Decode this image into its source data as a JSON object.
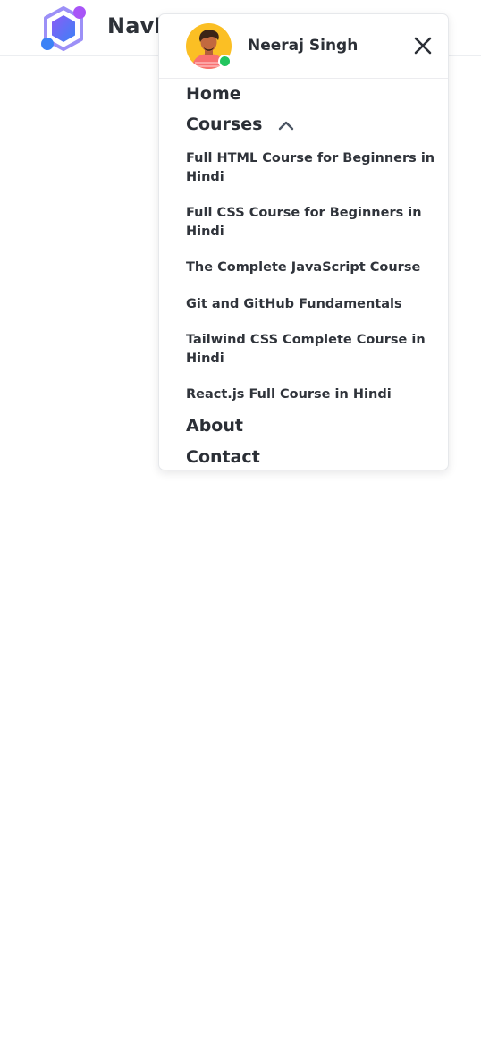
{
  "navbar": {
    "brand": "NavBar",
    "logo_icon": "hexagon-logo-icon",
    "colors": {
      "logo_primary": "#6366f1",
      "logo_secondary": "#a855f7",
      "logo_accent": "#3b82f6"
    }
  },
  "menu": {
    "user": {
      "name": "Neeraj Singh",
      "avatar_icon": "user-avatar-icon",
      "status": "online",
      "status_color": "#22c55e",
      "avatar_bg": "#fbbf24"
    },
    "close_icon": "close-icon",
    "links": {
      "home": "Home",
      "courses": "Courses",
      "about": "About",
      "contact": "Contact"
    },
    "courses_expanded": true,
    "courses_chevron_icon": "chevron-up-icon",
    "courses": [
      "Full HTML Course for Beginners in Hindi",
      "Full CSS Course for Beginners in Hindi",
      "The Complete JavaScript Course",
      "Git and GitHub Fundamentals",
      "Tailwind CSS Complete Course in Hindi",
      "React.js Full Course in Hindi"
    ]
  }
}
